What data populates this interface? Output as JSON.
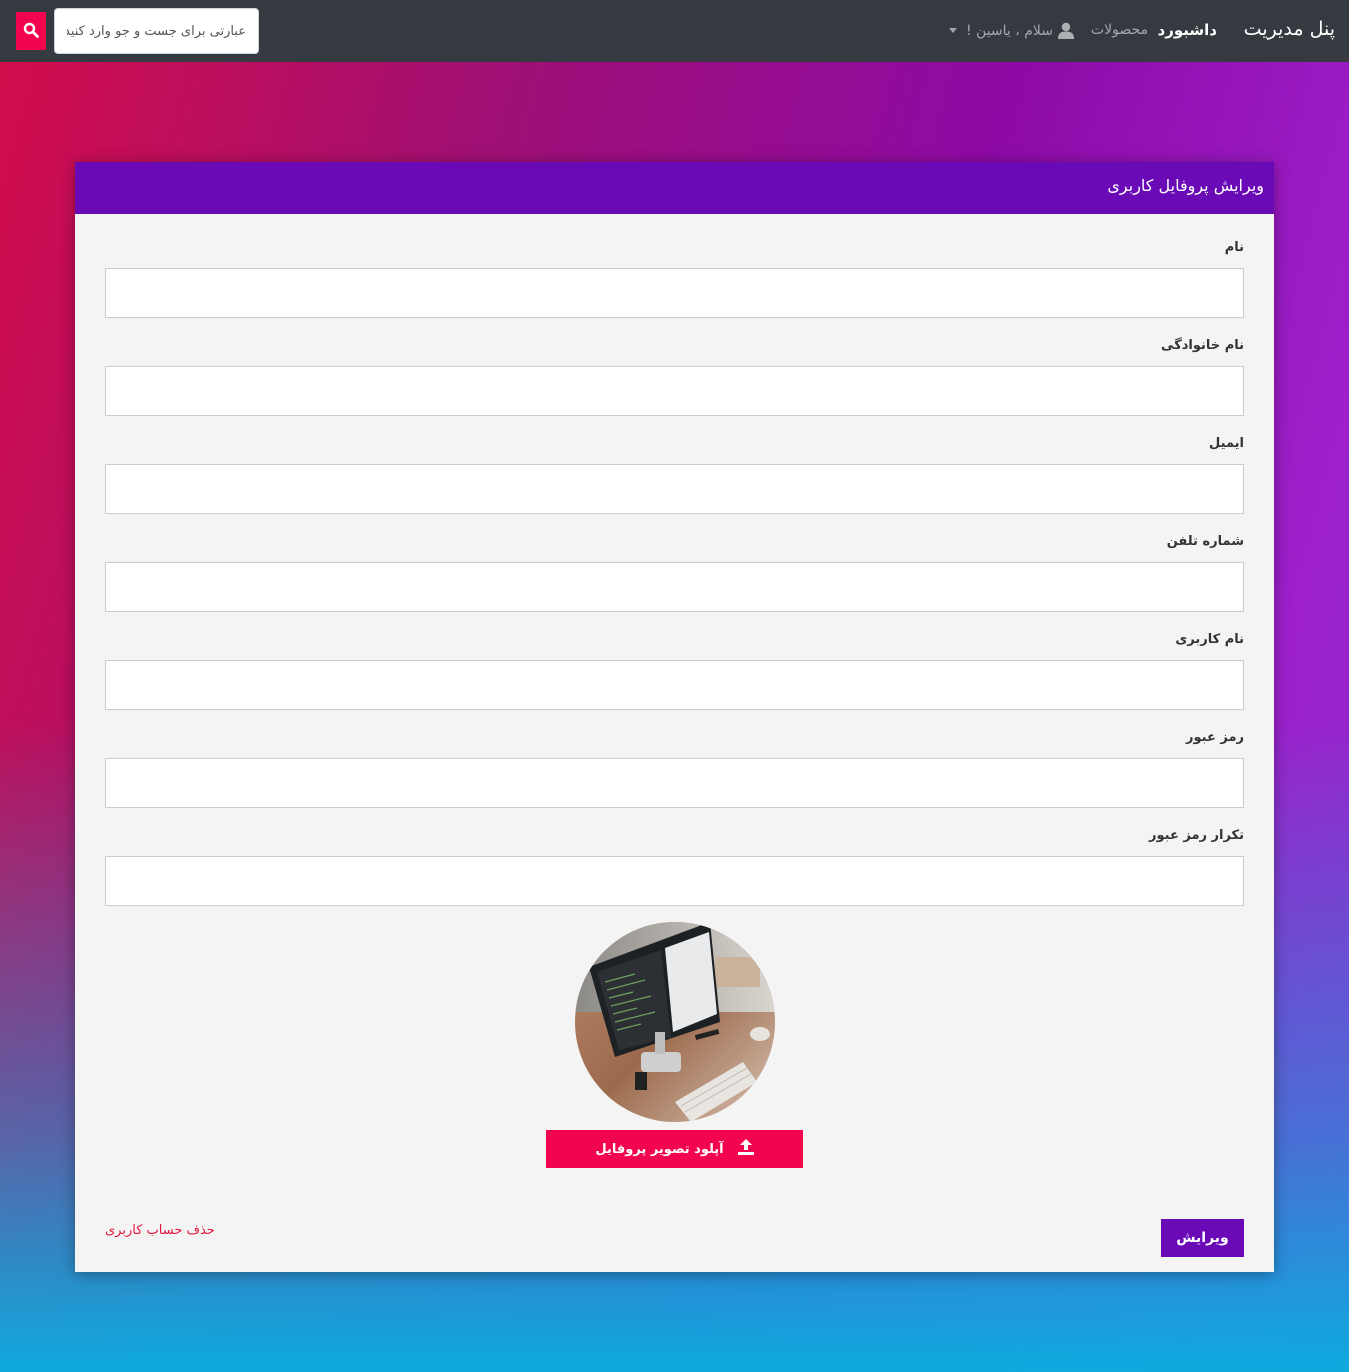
{
  "navbar": {
    "brand": "پنل مدیریت",
    "dashboard_label": "داشبورد",
    "products_label": "محصولات",
    "user_greeting": "سلام ، یاسین !",
    "search_placeholder": "عبارتی برای جست و جو وارد کنید"
  },
  "form": {
    "title": "ویرایش پروفایل کاربری",
    "fields": [
      {
        "label": "نام",
        "value": ""
      },
      {
        "label": "نام خانوادگی",
        "value": ""
      },
      {
        "label": "ایمیل",
        "value": ""
      },
      {
        "label": "شماره تلفن",
        "value": ""
      },
      {
        "label": "نام کاربری",
        "value": ""
      },
      {
        "label": "رمز عبور",
        "value": ""
      },
      {
        "label": "تکرار رمز عبور",
        "value": ""
      }
    ],
    "upload_label": "آپلود تصویر پروفایل",
    "submit_label": "ویرایش",
    "delete_label": "حذف حساب کاربری"
  },
  "colors": {
    "navbar": "#343a40",
    "accent_pink": "#f2044f",
    "accent_purple": "#6a0ab7",
    "danger": "#e0193c"
  },
  "icons": {
    "search": "search-icon",
    "user": "user-icon",
    "upload": "upload-icon"
  }
}
